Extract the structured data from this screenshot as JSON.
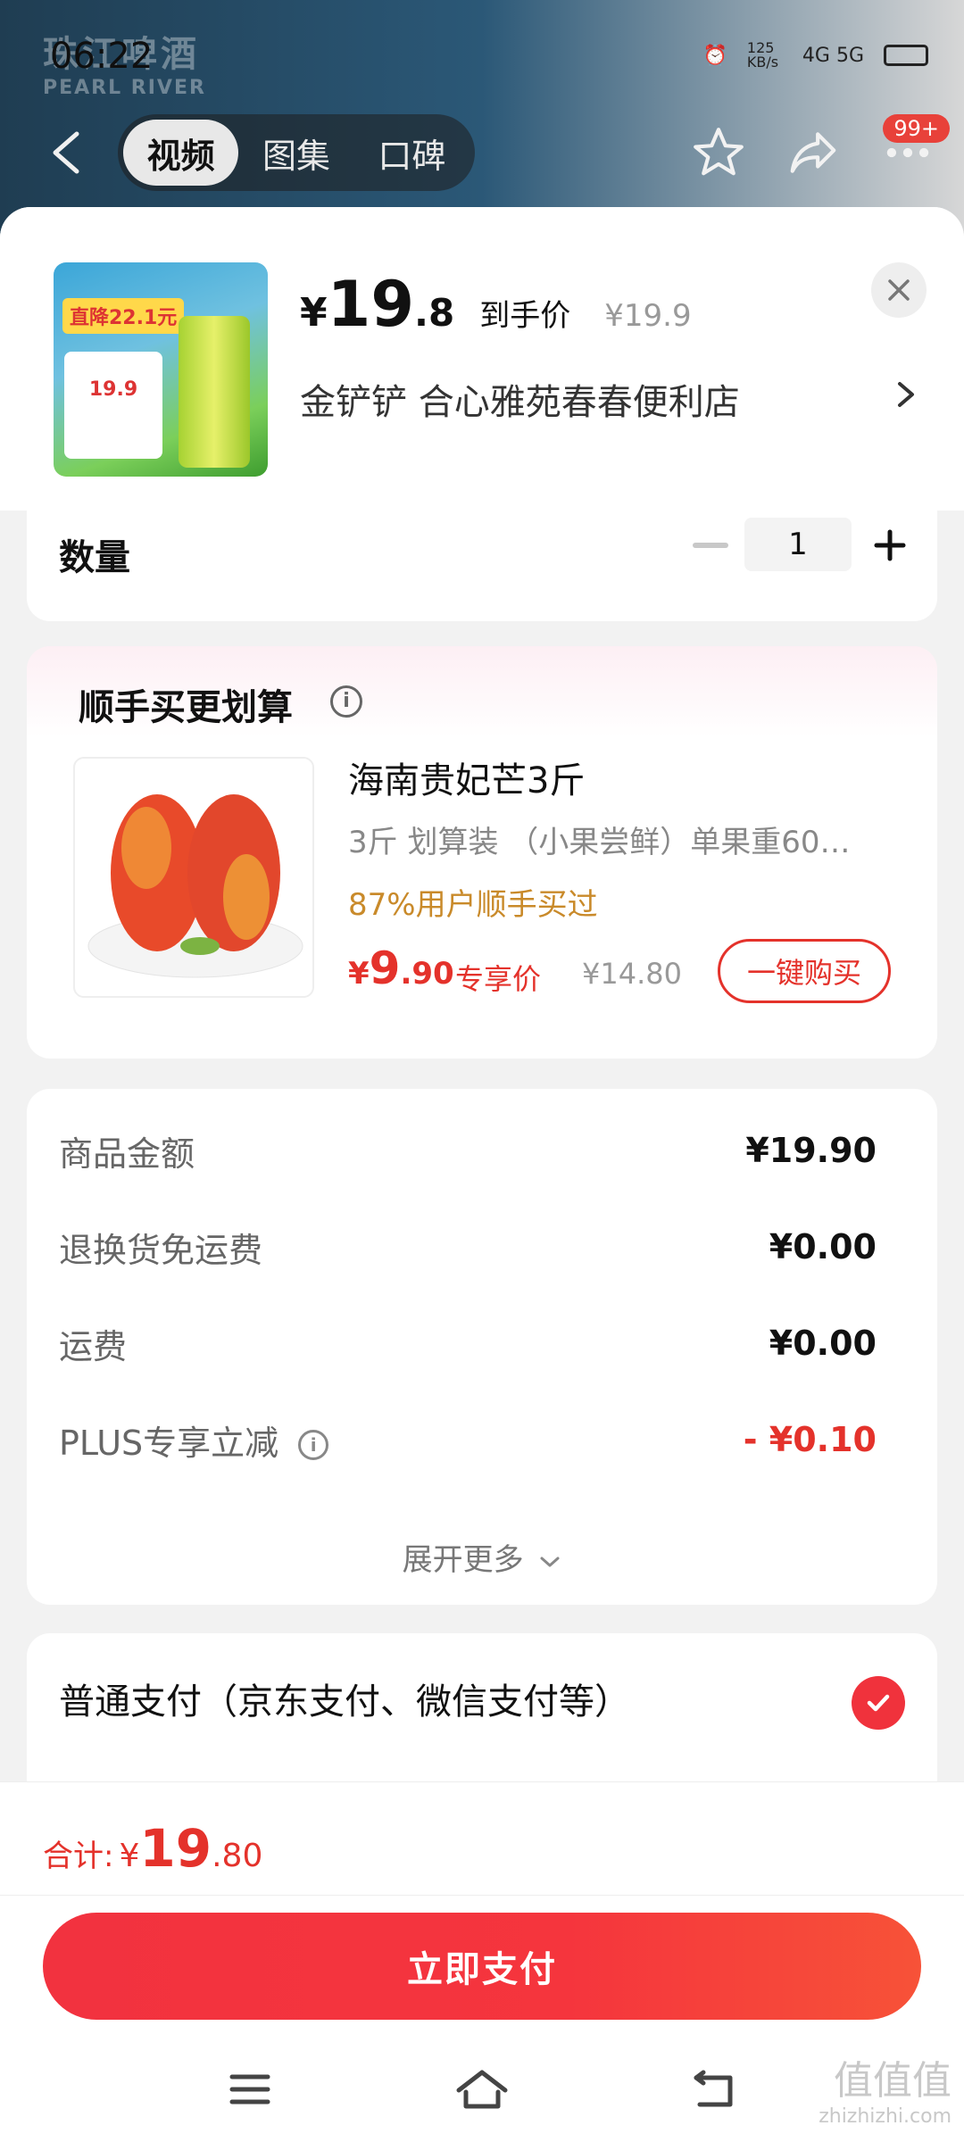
{
  "status_bar": {
    "time": "06:22",
    "network_speed": "125 KB/s",
    "signal": "4G 5G"
  },
  "background": {
    "brand_text": "珠江啤酒",
    "brand_sub": "PEARL RIVER"
  },
  "top_nav": {
    "tabs": [
      {
        "label": "视频",
        "active": true
      },
      {
        "label": "图集",
        "active": false
      },
      {
        "label": "口碑",
        "active": false
      }
    ],
    "badge": "99+"
  },
  "product": {
    "price_symbol": "¥",
    "price_int": "19",
    "price_dec": ".8",
    "price_tag": "到手价",
    "original_price": "¥19.9",
    "store": "金铲铲  合心雅苑春春便利店",
    "thumb_tag": "直降22.1元",
    "thumb_price": "19.9"
  },
  "quantity": {
    "label": "数量",
    "value": "1"
  },
  "recommend": {
    "title": "顺手买更划算",
    "name": "海南贵妃芒3斤",
    "desc": "3斤 划算装  （小果尝鲜）单果重60…",
    "social": "87%用户顺手买过",
    "price_symbol": "¥",
    "price_int": "9",
    "price_dec": ".90",
    "price_tag": "专享价",
    "original_price": "¥14.80",
    "buy_label": "一键购买"
  },
  "summary": {
    "rows": [
      {
        "label": "商品金额",
        "value": "¥19.90"
      },
      {
        "label": "退换货免运费",
        "value": "¥0.00"
      },
      {
        "label": "运费",
        "value": "¥0.00"
      },
      {
        "label": "PLUS专享立减",
        "value": "- ¥0.10"
      }
    ],
    "expand_label": "展开更多"
  },
  "payment": {
    "option_label": "普通支付（京东支付、微信支付等）"
  },
  "bottom": {
    "total_label": "合计:",
    "total_symbol": "¥",
    "total_int": "19",
    "total_dec": ".80",
    "pay_button": "立即支付"
  },
  "watermark": "值值值",
  "watermark_sub": "zhizhizhi.com"
}
